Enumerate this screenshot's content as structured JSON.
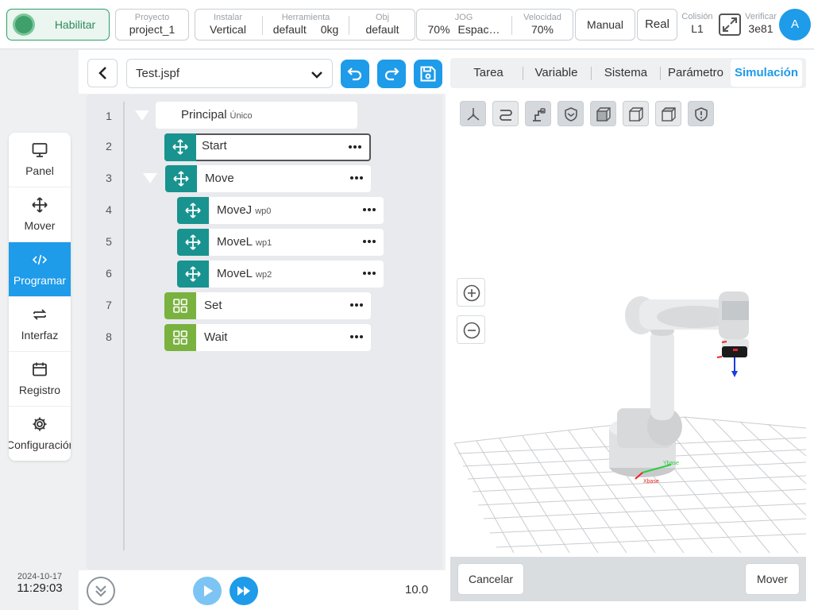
{
  "topbar": {
    "enable_label": "Habilitar",
    "project": {
      "label": "Proyecto",
      "value": "project_1"
    },
    "install": {
      "label": "Instalar",
      "value": "Vertical"
    },
    "tool": {
      "label": "Herramienta",
      "value": "default",
      "value2": "0kg"
    },
    "obj": {
      "label": "Obj",
      "value": "default"
    },
    "jog": {
      "label": "JOG",
      "value": "70%",
      "value2": "Espac…"
    },
    "speed": {
      "label": "Velocidad",
      "value": "70%"
    },
    "mode_manual": "Manual",
    "mode_real": "Real",
    "collision": {
      "label": "Colisión",
      "value": "L1"
    },
    "verify": {
      "label": "Verificar",
      "value": "3e81"
    },
    "avatar": "A"
  },
  "sidebar": {
    "items": [
      {
        "label": "Panel",
        "icon": "monitor-icon"
      },
      {
        "label": "Mover",
        "icon": "move-arrows-icon"
      },
      {
        "label": "Programar",
        "icon": "code-icon",
        "active": true
      },
      {
        "label": "Interfaz",
        "icon": "swap-icon"
      },
      {
        "label": "Registro",
        "icon": "calendar-icon"
      },
      {
        "label": "Configuración",
        "icon": "gear-icon"
      }
    ],
    "date": "2024-10-17",
    "time": "11:29:03"
  },
  "editor": {
    "file_name": "Test.jspf",
    "tree": [
      {
        "line": "1",
        "label": "Principal",
        "sub": "Único"
      },
      {
        "line": "2",
        "label": "Start",
        "sub": ""
      },
      {
        "line": "3",
        "label": "Move",
        "sub": ""
      },
      {
        "line": "4",
        "label": "MoveJ",
        "sub": "wp0"
      },
      {
        "line": "5",
        "label": "MoveL",
        "sub": "wp1"
      },
      {
        "line": "6",
        "label": "MoveL",
        "sub": "wp2"
      },
      {
        "line": "7",
        "label": "Set",
        "sub": ""
      },
      {
        "line": "8",
        "label": "Wait",
        "sub": ""
      }
    ],
    "speed_value": "10.0"
  },
  "right": {
    "tabs": [
      "Tarea",
      "Variable",
      "Sistema",
      "Parámetro",
      "Simulación"
    ],
    "active_tab": "Simulación",
    "cancel_label": "Cancelar",
    "move_label": "Mover",
    "axis_x": "Xbase",
    "axis_y": "Ybase"
  },
  "colors": {
    "accent": "#1e9be9",
    "teal": "#19938f",
    "olive": "#7ab240",
    "enable_green": "#3fa06b"
  }
}
